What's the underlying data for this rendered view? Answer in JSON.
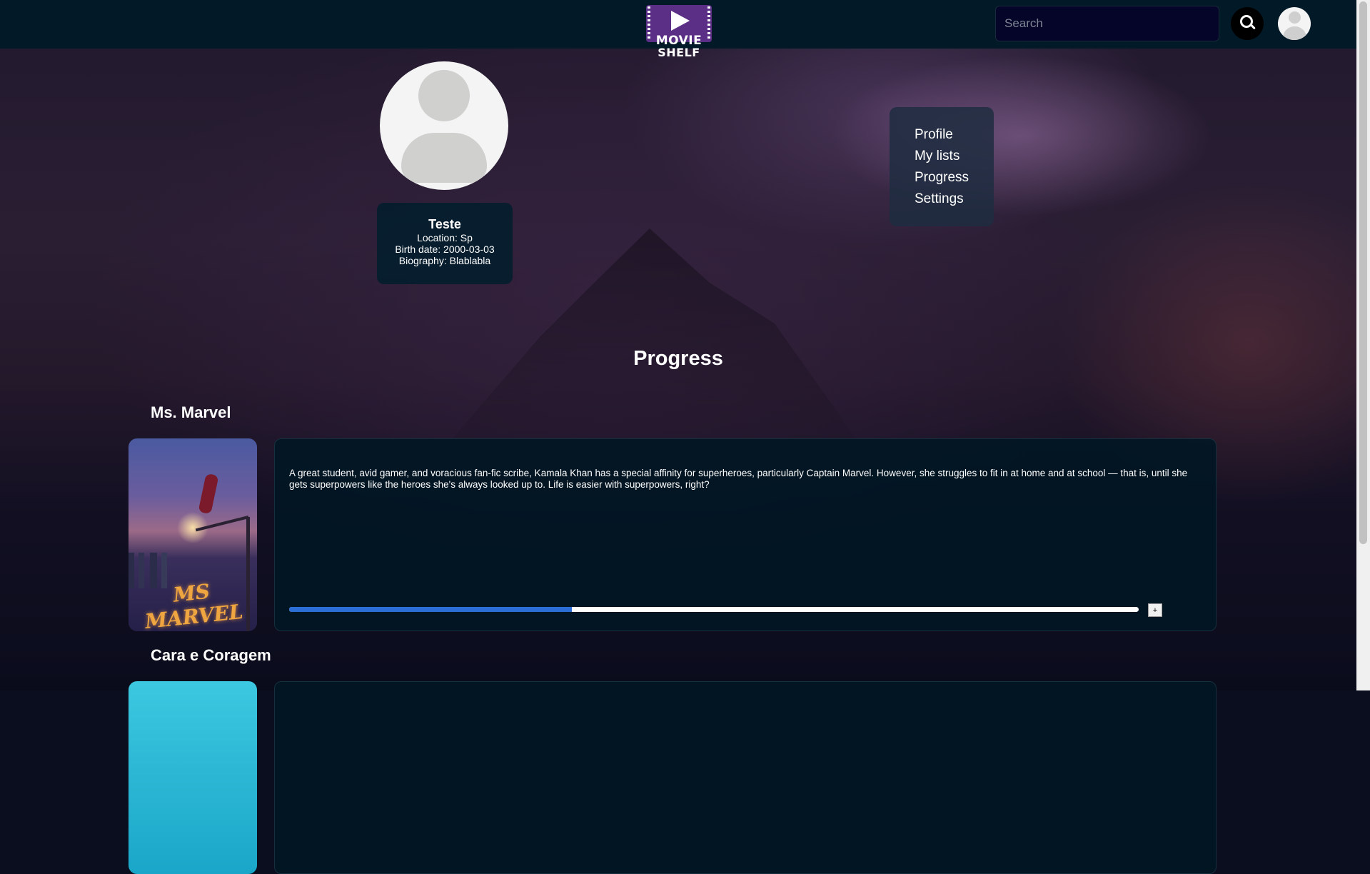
{
  "header": {
    "logo_line1": "MOVIE",
    "logo_line2": "SHELF",
    "search_placeholder": "Search",
    "search_icon": "search-icon",
    "avatar_icon": "user-avatar-icon"
  },
  "profile": {
    "name": "Teste",
    "location": "Location: Sp",
    "birth_date": "Birth date: 2000-03-03",
    "biography": "Biography: Blablabla"
  },
  "menu": {
    "items": [
      {
        "label": "Profile"
      },
      {
        "label": "My lists"
      },
      {
        "label": "Progress"
      },
      {
        "label": "Settings"
      }
    ]
  },
  "page": {
    "section_title": "Progress"
  },
  "shows": [
    {
      "title": "Ms. Marvel",
      "poster_text": "MS MARVEL",
      "description": "A great student, avid gamer, and voracious fan-fic scribe, Kamala Khan has a special affinity for superheroes, particularly Captain Marvel. However, she struggles to fit in at home and at school — that is, until she gets superpowers like the heroes she's always looked up to. Life is easier with superpowers, right?",
      "progress_fraction": 0.333,
      "increment_label": "+"
    },
    {
      "title": "Cara e Coragem"
    }
  ],
  "colors": {
    "header_bg": "#021a28",
    "accent_progress": "#2b6fd6",
    "logo_purple": "#5b2f86"
  }
}
